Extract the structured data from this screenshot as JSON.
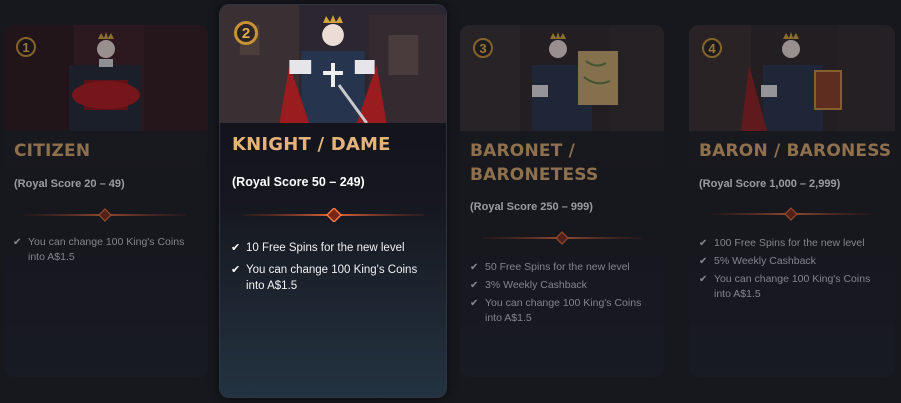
{
  "tiers": [
    {
      "number": "1",
      "title": "CITIZEN",
      "score": "(Royal Score 20 – 49)",
      "perks": [
        "You can change 100 King's Coins into A$1.5"
      ],
      "illustration": "king-holding-red-cushion"
    },
    {
      "number": "2",
      "title": "KNIGHT / DAME",
      "score": "(Royal Score 50 – 249)",
      "perks": [
        "10 Free Spins for the new level",
        "You can change 100 King's Coins into A$1.5"
      ],
      "illustration": "king-with-sword"
    },
    {
      "number": "3",
      "title": "BARONET / BARONETESS",
      "score": "(Royal Score 250 – 999)",
      "perks": [
        "50 Free Spins for the new level",
        "3% Weekly Cashback",
        "You can change 100 King's Coins into A$1.5"
      ],
      "illustration": "king-holding-treasure-map"
    },
    {
      "number": "4",
      "title": "BARON / BARONESS",
      "score": "(Royal Score 1,000 – 2,999)",
      "perks": [
        "100 Free Spins for the new level",
        "5% Weekly Cashback",
        "You can change 100 King's Coins into A$1.5"
      ],
      "illustration": "king-holding-book"
    }
  ],
  "colors": {
    "title": "#d9a66a",
    "badge": "#c89235",
    "divider": "#c44a2a",
    "background": "#17181d"
  },
  "icons": {
    "perk": "check-icon",
    "badge": "number-badge-icon"
  }
}
